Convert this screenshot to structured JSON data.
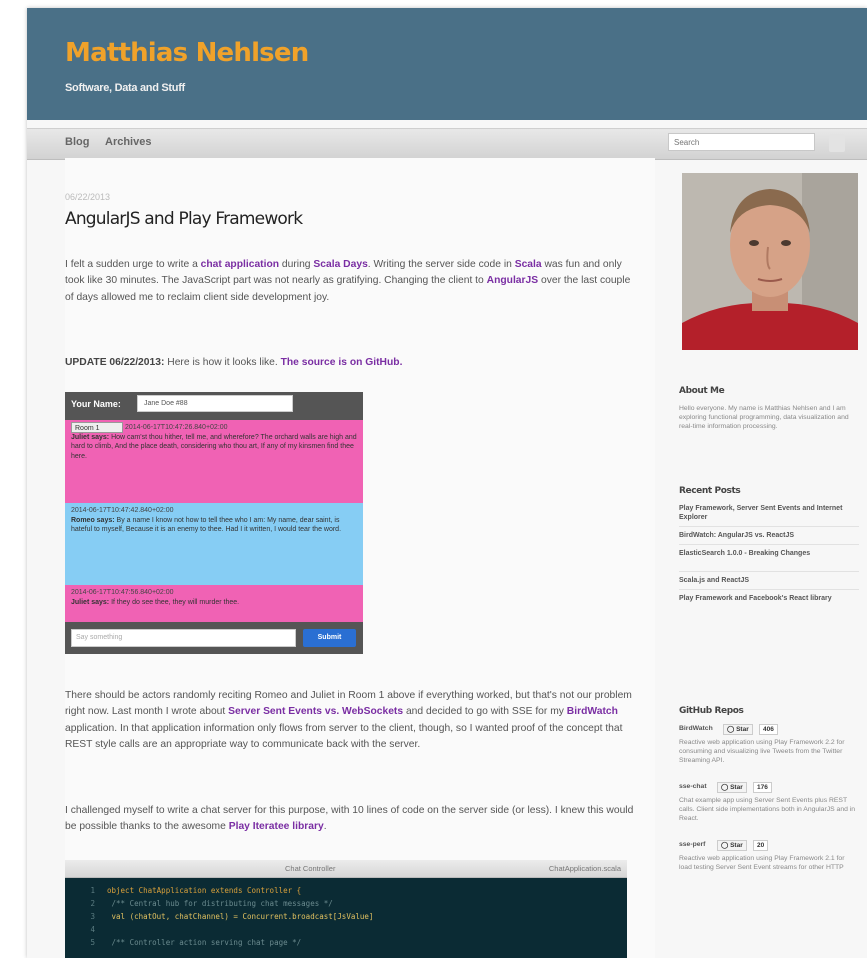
{
  "header": {
    "title": "Matthias Nehlsen",
    "subtitle": "Software, Data and Stuff"
  },
  "nav": {
    "items": [
      "Blog",
      "Archives"
    ],
    "search_placeholder": "Search"
  },
  "post": {
    "date": "06/22/2013",
    "title": "AngularJS and Play Framework",
    "p1": {
      "t1": "I felt a sudden urge to write a ",
      "link1": "chat application",
      "t2": " during ",
      "link2": "Scala Days",
      "t3": ". Writing the server side code in ",
      "link3": "Scala",
      "t4": " was fun and only took like 30 minutes. The JavaScript part was not nearly as gratifying. Changing the client to ",
      "link4": "AngularJS",
      "t5": " over the last couple of days allowed me to reclaim client side development joy."
    },
    "p2": {
      "update": "UPDATE 06/22/2013:",
      "t1": " Here is how it looks like. ",
      "link": "The source is on GitHub."
    },
    "p3": {
      "t1": "There should be actors randomly reciting Romeo and Juliet in Room 1 above if everything worked, but that's not our problem right now. Last month I wrote about ",
      "link1": "Server Sent Events vs. WebSockets",
      "t2": " and decided to go with SSE for my ",
      "link2": "BirdWatch",
      "t3": " application. In that application information only flows from server to the client, though, so I wanted proof of the concept that REST style calls are an appropriate way to communicate back with the server."
    },
    "p4": {
      "t1": "I challenged myself to write a chat server for this purpose, with 10 lines of code on the server side (or less). I knew this would be possible thanks to the awesome ",
      "link": "Play Iteratee library",
      "t2": "."
    }
  },
  "chat_demo": {
    "name_label": "Your Name:",
    "name_value": "Jane Doe #88",
    "room_select": "Room 1",
    "messages": [
      {
        "ts": "2014-06-17T10:47:26.840+02:00",
        "author": "Juliet says:",
        "text": " How cam'st thou hither, tell me, and wherefore? The orchard walls are high and hard to climb, And the place death, considering who thou art, If any of my kinsmen find thee here.",
        "color": "#f062b4"
      },
      {
        "ts": "2014-06-17T10:47:42.840+02:00",
        "author": "Romeo says:",
        "text": " By a name I know not how to tell thee who I am: My name, dear saint, is hateful to myself, Because it is an enemy to thee. Had I it written, I would tear the word.",
        "color": "#86cdf4"
      },
      {
        "ts": "2014-06-17T10:47:56.840+02:00",
        "author": "Juliet says:",
        "text": " If they do see thee, they will murder thee.",
        "color": "#f062b4"
      }
    ],
    "say_placeholder": "Say something",
    "submit_label": "Submit"
  },
  "code": {
    "bar_title": "Chat Controller",
    "bar_file": "ChatApplication.scala",
    "lines": [
      {
        "n": "1",
        "text": "object ChatApplication extends Controller {",
        "color": "#d9a03b"
      },
      {
        "n": "2",
        "text": "  /** Central hub for distributing chat messages */",
        "color": "#6a8a8e"
      },
      {
        "n": "3",
        "text": "  val (chatOut, chatChannel) = Concurrent.broadcast[JsValue]",
        "color": "#e0c060"
      },
      {
        "n": "4",
        "text": "",
        "color": "#6a8a8e"
      },
      {
        "n": "5",
        "text": "  /** Controller action serving chat page */",
        "color": "#6a8a8e"
      }
    ]
  },
  "sidebar": {
    "about_title": "About Me",
    "about_text": "Hello everyone. My name is Matthias Nehlsen and I am exploring functional programming, data visualization and real-time information processing.",
    "recent_title": "Recent Posts",
    "recent_posts": [
      "Play Framework, Server Sent Events and Internet Explorer",
      "BirdWatch: AngularJS vs. ReactJS",
      "ElasticSearch 1.0.0 - Breaking Changes",
      "Scala.js and ReactJS",
      "Play Framework and Facebook's React library"
    ],
    "github_title": "GitHub Repos",
    "repos": [
      {
        "name": "BirdWatch",
        "star": "Star",
        "count": "406",
        "desc": "Reactive web application using Play Framework 2.2 for consuming and visualizing live Tweets from the Twitter Streaming API."
      },
      {
        "name": "sse-chat",
        "star": "Star",
        "count": "176",
        "desc": "Chat example app using Server Sent Events plus REST calls. Client side implementations both in AngularJS and in React."
      },
      {
        "name": "sse-perf",
        "star": "Star",
        "count": "20",
        "desc": "Reactive web application using Play Framework 2.1 for load testing Server Sent Event streams for other HTTP"
      }
    ]
  }
}
